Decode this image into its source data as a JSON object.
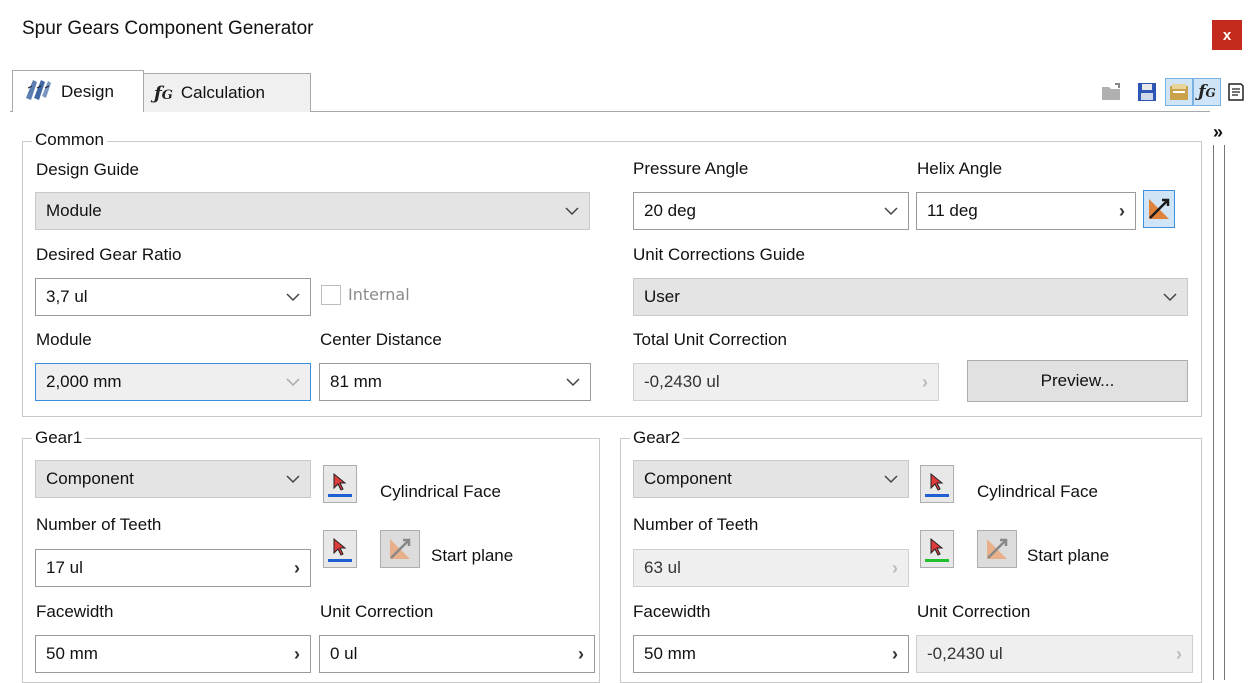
{
  "window": {
    "title": "Spur Gears Component Generator",
    "close_label": "x"
  },
  "tabs": [
    {
      "label": "Design",
      "icon": "gear-design-icon"
    },
    {
      "label": "Calculation",
      "icon": "fx-calculation-icon"
    }
  ],
  "toolbar": [
    "open-folder-icon",
    "save-icon",
    "options-icon",
    "fx-icon",
    "notes-icon"
  ],
  "expand_label": "»",
  "common": {
    "legend": "Common",
    "design_guide": {
      "label": "Design Guide",
      "value": "Module"
    },
    "pressure_angle": {
      "label": "Pressure Angle",
      "value": "20 deg"
    },
    "helix_angle": {
      "label": "Helix Angle",
      "value": "11 deg"
    },
    "gear_ratio": {
      "label": "Desired Gear Ratio",
      "value": "3,7 ul"
    },
    "internal": {
      "label": "Internal",
      "checked": false
    },
    "unit_corrections_guide": {
      "label": "Unit Corrections Guide",
      "value": "User"
    },
    "module": {
      "label": "Module",
      "value": "2,000 mm"
    },
    "center_distance": {
      "label": "Center Distance",
      "value": "81 mm"
    },
    "total_unit_correction": {
      "label": "Total Unit Correction",
      "value": "-0,2430 ul"
    },
    "preview_label": "Preview..."
  },
  "gear1": {
    "legend": "Gear1",
    "type": "Component",
    "cylindrical_face": "Cylindrical Face",
    "start_plane": "Start plane",
    "teeth_label": "Number of Teeth",
    "teeth_value": "17 ul",
    "facewidth_label": "Facewidth",
    "facewidth_value": "50 mm",
    "unit_correction_label": "Unit Correction",
    "unit_correction_value": "0 ul"
  },
  "gear2": {
    "legend": "Gear2",
    "type": "Component",
    "cylindrical_face": "Cylindrical Face",
    "start_plane": "Start plane",
    "teeth_label": "Number of Teeth",
    "teeth_value": "63 ul",
    "facewidth_label": "Facewidth",
    "facewidth_value": "50 mm",
    "unit_correction_label": "Unit Correction",
    "unit_correction_value": "-0,2430 ul"
  },
  "colors": {
    "close": "#c42b1c",
    "pick_blue": "#1f5fd1",
    "pick_green": "#22c02e",
    "focus": "#3b8fdb"
  }
}
